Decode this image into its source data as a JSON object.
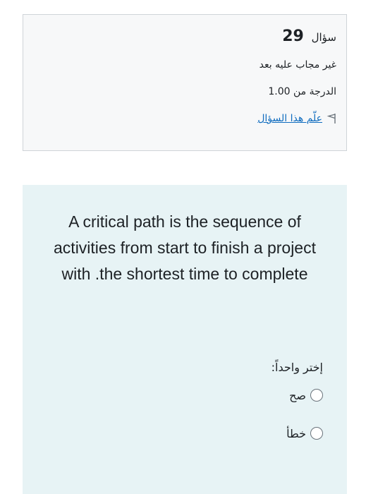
{
  "question_info": {
    "label": "سؤال",
    "number": "29",
    "state": "غير مجاب عليه بعد",
    "grade": "الدرجة من 1.00",
    "flag_label": "علّم هذا السؤال"
  },
  "question": {
    "text": "A critical path is the sequence of activities from start to finish a project with .the shortest time to complete",
    "prompt": "إختر واحداً:",
    "options": [
      {
        "label": "صح"
      },
      {
        "label": "خطأ"
      }
    ]
  },
  "colors": {
    "info_bg": "#f7f8f9",
    "content_bg": "#e7f3f5",
    "link": "#0f6cbf"
  },
  "icons": {
    "flag": "flag-outline-icon"
  }
}
